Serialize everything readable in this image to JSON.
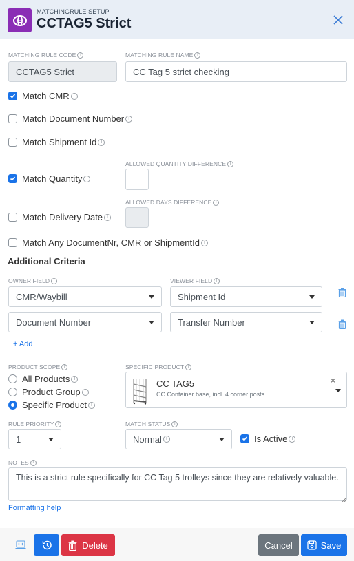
{
  "header": {
    "subtitle": "MATCHINGRULE SETUP",
    "title": "CCTAG5 Strict",
    "icon": "matching-rule-icon",
    "accent_color": "#8a2db5"
  },
  "fields": {
    "code_label": "MATCHING RULE CODE",
    "code_value": "CCTAG5 Strict",
    "name_label": "MATCHING RULE NAME",
    "name_value": "CC Tag 5 strict checking"
  },
  "checks": {
    "match_cmr": {
      "label": "Match CMR",
      "checked": true
    },
    "match_document_number": {
      "label": "Match Document Number",
      "checked": false
    },
    "match_shipment_id": {
      "label": "Match Shipment Id",
      "checked": false
    },
    "match_quantity": {
      "label": "Match Quantity",
      "checked": true
    },
    "match_delivery_date": {
      "label": "Match Delivery Date",
      "checked": false
    },
    "match_any": {
      "label": "Match Any DocumentNr, CMR or ShipmentId",
      "checked": false
    }
  },
  "quantity_diff": {
    "label": "ALLOWED QUANTITY DIFFERENCE",
    "value": ""
  },
  "days_diff": {
    "label": "ALLOWED DAYS DIFFERENCE",
    "value": ""
  },
  "additional": {
    "title": "Additional Criteria",
    "owner_label": "OWNER FIELD",
    "viewer_label": "VIEWER FIELD",
    "rows": [
      {
        "owner": "CMR/Waybill",
        "viewer": "Shipment Id"
      },
      {
        "owner": "Document Number",
        "viewer": "Transfer Number"
      }
    ],
    "add_label": "+ Add"
  },
  "product_scope": {
    "label": "PRODUCT SCOPE",
    "options": [
      "All Products",
      "Product Group",
      "Specific Product"
    ],
    "selected": "Specific Product"
  },
  "specific_product": {
    "label": "SPECIFIC PRODUCT",
    "name": "CC TAG5",
    "description": "CC Container base, incl. 4 corner posts",
    "clear_label": "×"
  },
  "priority": {
    "label": "RULE PRIORITY",
    "value": "1"
  },
  "match_status": {
    "label": "MATCH STATUS",
    "value": "Normal"
  },
  "is_active": {
    "label": "Is Active",
    "checked": true
  },
  "notes": {
    "label": "NOTES",
    "value": "This is a strict rule specifically for CC Tag 5 trolleys since they are relatively valuable.",
    "help_link": "Formatting help"
  },
  "footer": {
    "delete_label": "Delete",
    "cancel_label": "Cancel",
    "save_label": "Save",
    "colors": {
      "primary": "#1a73e8",
      "danger": "#dc3545",
      "secondary": "#6c757d"
    }
  }
}
